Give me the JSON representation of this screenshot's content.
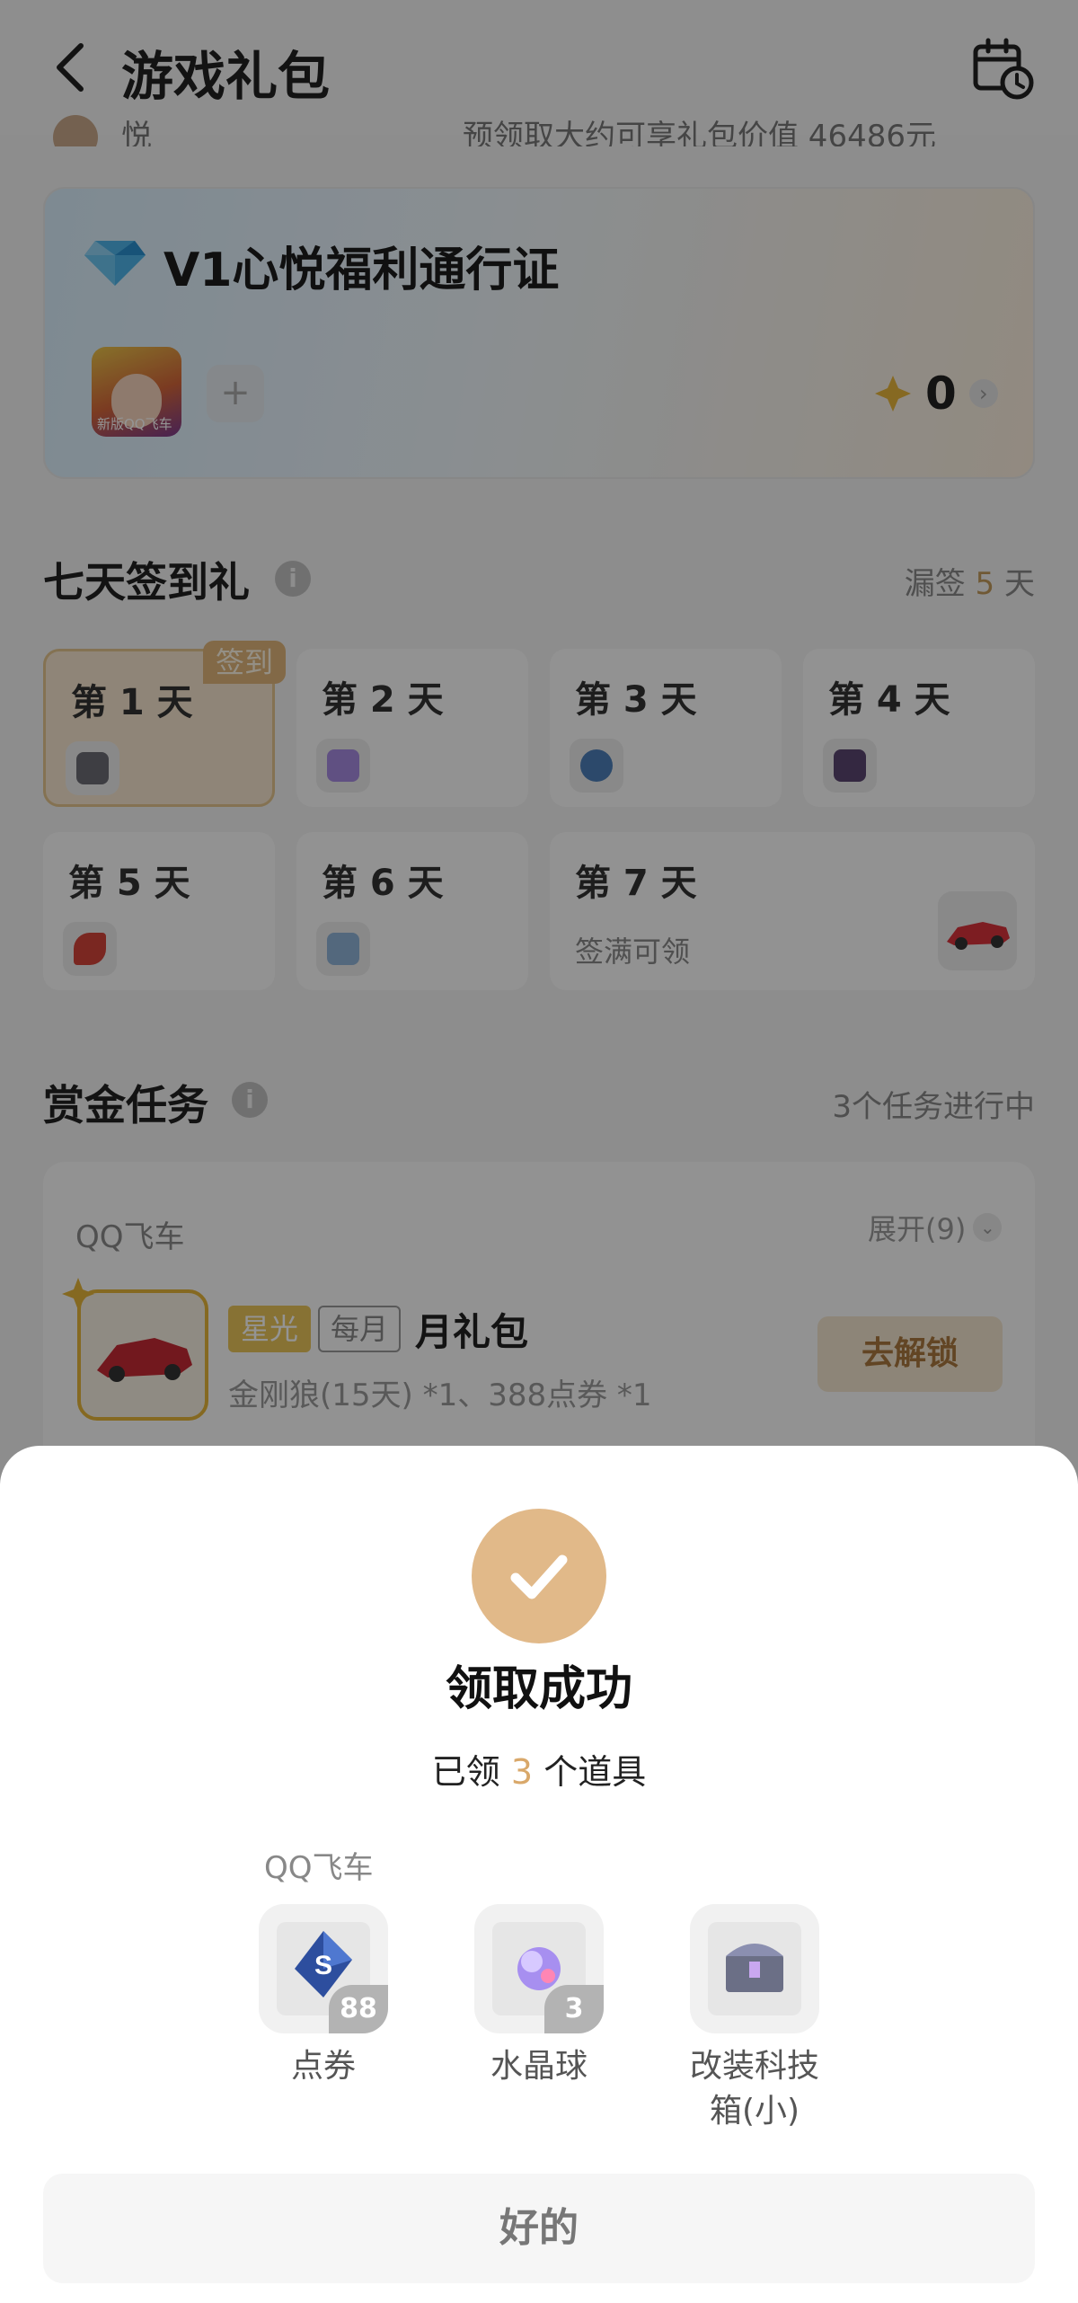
{
  "header": {
    "title": "游戏礼包",
    "peek_name": "悦",
    "peek_text": "预领取大约可享礼包价值 46486元"
  },
  "pass": {
    "title": "V1心悦福利通行证",
    "game_tile_label": "新版QQ飞车",
    "add_label": "+",
    "points": "0",
    "arrow": "›"
  },
  "signin": {
    "title": "七天签到礼",
    "info": "i",
    "missed_prefix": "漏签",
    "missed_count": "5",
    "missed_suffix": "天",
    "badge": "签到",
    "days": [
      {
        "label": "第 1 天"
      },
      {
        "label": "第 2 天"
      },
      {
        "label": "第 3 天"
      },
      {
        "label": "第 4 天"
      },
      {
        "label": "第 5 天"
      },
      {
        "label": "第 6 天"
      },
      {
        "label": "第 7 天",
        "sub": "签满可领"
      }
    ]
  },
  "bounty": {
    "title": "赏金任务",
    "info": "i",
    "status": "3个任务进行中",
    "task": {
      "game": "QQ飞车",
      "expand": "展开(9)",
      "tag_star": "星光",
      "tag_month": "每月",
      "name": "月礼包",
      "desc": "金刚狼(15天) *1、388点券 *1",
      "button": "去解锁"
    }
  },
  "sheet": {
    "title": "领取成功",
    "sub_prefix": "已领",
    "sub_count": "3",
    "sub_suffix": "个道具",
    "game": "QQ飞车",
    "rewards": [
      {
        "name": "点券",
        "qty": "88"
      },
      {
        "name": "水晶球",
        "qty": "3"
      },
      {
        "name": "改装科技箱(小)",
        "qty": ""
      }
    ],
    "ok": "好的"
  },
  "colors": {
    "accent": "#e1b989",
    "tag_star": "#e8c45a",
    "unlock_text": "#a9783e"
  },
  "icons": [
    "back-arrow-icon",
    "calendar-clock-icon",
    "diamond-icon",
    "star-point-icon",
    "info-icon",
    "chevron-down-icon",
    "checkmark-icon"
  ]
}
